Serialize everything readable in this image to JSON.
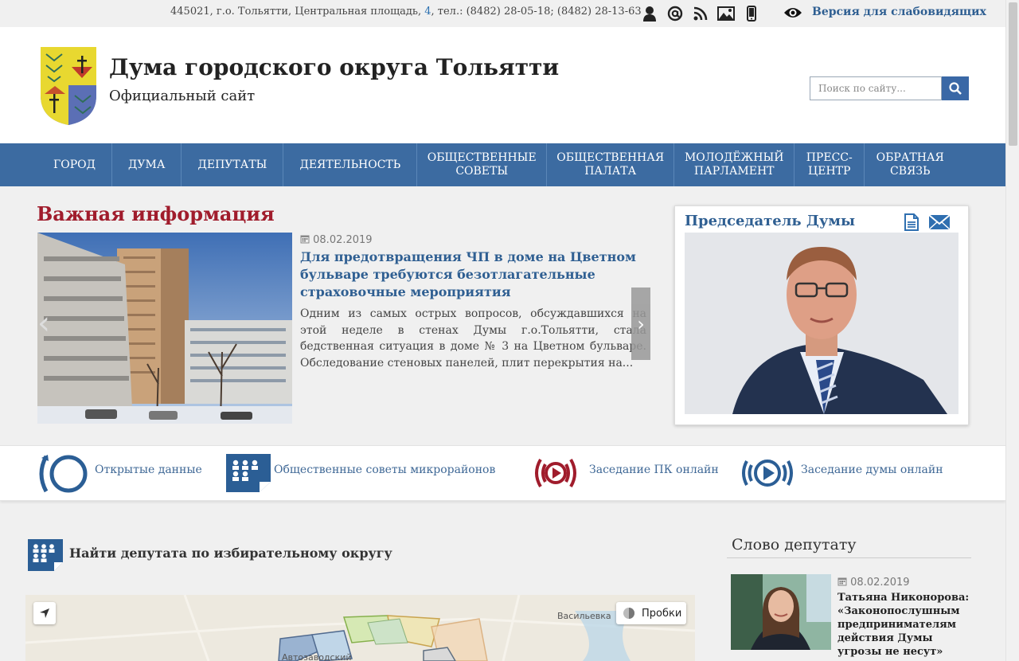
{
  "topbar": {
    "address": "445021, г.о. Тольятти, Центральная площадь, ",
    "address_num": "4",
    "phones": ",  тел.: (8482) 28-05-18; (8482) 28-13-63",
    "icons": [
      "user-icon",
      "at-icon",
      "rss-icon",
      "photo-icon",
      "mobile-icon",
      "eye-icon"
    ],
    "vision_link": "Версия для слабовидящих"
  },
  "header": {
    "title": "Дума городского округа Тольятти",
    "subtitle": "Официальный сайт",
    "search_placeholder": "Поиск по сайту..."
  },
  "nav": {
    "items": [
      {
        "label": "Город"
      },
      {
        "label": "Дума"
      },
      {
        "label": "Депутаты"
      },
      {
        "label": "Деятельность"
      },
      {
        "label": "Общественные советы"
      },
      {
        "label": "Общественная палата"
      },
      {
        "label": "Молодёжный парламент"
      },
      {
        "label": "Пресс-центр"
      },
      {
        "label": "Обратная связь"
      }
    ]
  },
  "important": {
    "title": "Важная информация",
    "date": "08.02.2019",
    "headline": "Для предотвращения ЧП в доме на Цветном бульваре требуются безотлагательные страховочные мероприятия",
    "text": "Одним из самых острых вопросов, обсуждавшихся на этой неделе в стенах Думы г.о.Тольятти, стала бедственная ситуация в доме № 3 на Цветном бульваре. Обследование стеновых панелей, плит перекрытия на..."
  },
  "chairman": {
    "title": "Председатель Думы"
  },
  "quick_links": [
    {
      "label": "Открытые данные"
    },
    {
      "label": "Общественные советы микрорайонов"
    },
    {
      "label": "Заседание ПК онлайн"
    },
    {
      "label": "Заседание думы онлайн"
    }
  ],
  "find_deputy": {
    "title": "Найти депутата по избирательному округу",
    "map_traffic": "Пробки",
    "map_labels": [
      "Васильевка",
      "Автозаводский"
    ]
  },
  "deputy_word": {
    "title": "Слово депутату",
    "date": "08.02.2019",
    "headline": "Татьяна Никонорова: «Законопослушным предпринимателям действия Думы угрозы не несут»"
  },
  "colors": {
    "nav_bg": "#3c6ba1",
    "accent_red": "#a01c2c",
    "link_blue": "#2f5f92"
  }
}
